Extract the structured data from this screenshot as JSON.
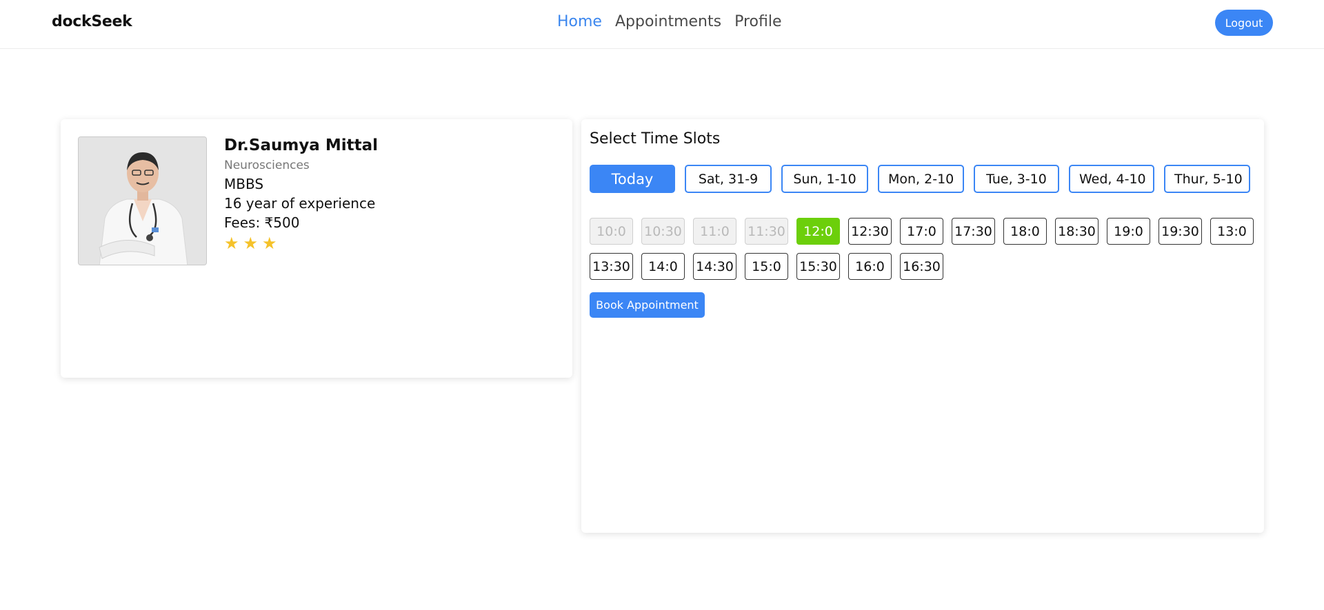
{
  "brand": "dockSeek",
  "nav": {
    "home": "Home",
    "appointments": "Appointments",
    "profile": "Profile",
    "logout": "Logout"
  },
  "doctor": {
    "name": "Dr.Saumya Mittal",
    "specialty": "Neurosciences",
    "degree": "MBBS",
    "experience": "16 year of experience",
    "fees": "Fees: ₹500",
    "rating": 3
  },
  "slots": {
    "title": "Select Time Slots",
    "days": [
      "Today",
      "Sat, 31-9",
      "Sun, 1-10",
      "Mon, 2-10",
      "Tue, 3-10",
      "Wed, 4-10",
      "Thur, 5-10"
    ],
    "selected_day": "Today",
    "times": [
      {
        "label": "10:0",
        "state": "disabled"
      },
      {
        "label": "10:30",
        "state": "disabled"
      },
      {
        "label": "11:0",
        "state": "disabled"
      },
      {
        "label": "11:30",
        "state": "disabled"
      },
      {
        "label": "12:0",
        "state": "selected"
      },
      {
        "label": "12:30",
        "state": "available"
      },
      {
        "label": "17:0",
        "state": "available"
      },
      {
        "label": "17:30",
        "state": "available"
      },
      {
        "label": "18:0",
        "state": "available"
      },
      {
        "label": "18:30",
        "state": "available"
      },
      {
        "label": "19:0",
        "state": "available"
      },
      {
        "label": "19:30",
        "state": "available"
      },
      {
        "label": "13:0",
        "state": "available"
      },
      {
        "label": "13:30",
        "state": "available"
      },
      {
        "label": "14:0",
        "state": "available"
      },
      {
        "label": "14:30",
        "state": "available"
      },
      {
        "label": "15:0",
        "state": "available"
      },
      {
        "label": "15:30",
        "state": "available"
      },
      {
        "label": "16:0",
        "state": "available"
      },
      {
        "label": "16:30",
        "state": "available"
      }
    ],
    "book_label": "Book Appointment"
  },
  "colors": {
    "primary": "#3b86f5",
    "selected_slot": "#6ccf0b",
    "star": "#f5c22a"
  }
}
